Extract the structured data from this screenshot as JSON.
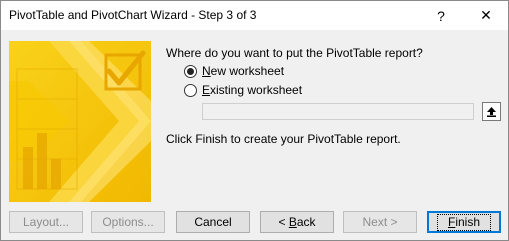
{
  "window": {
    "title": "PivotTable and PivotChart Wizard - Step 3 of 3",
    "help_label": "?",
    "close_label": "✕"
  },
  "form": {
    "question": "Where do you want to put the PivotTable report?",
    "options": [
      {
        "mnemonic": "N",
        "rest": "ew worksheet",
        "selected": true
      },
      {
        "mnemonic": "E",
        "rest": "xisting worksheet",
        "selected": false
      }
    ],
    "reference_value": "",
    "instructions": "Click Finish to create your PivotTable report."
  },
  "buttons": {
    "layout": {
      "mnemonic": "",
      "label": "Layout...",
      "enabled": false
    },
    "options": {
      "label": "Options...",
      "enabled": false
    },
    "cancel": {
      "label": "Cancel",
      "enabled": true
    },
    "back": {
      "pre": "< ",
      "mnemonic": "B",
      "rest": "ack",
      "enabled": true
    },
    "next": {
      "label": "Next >",
      "enabled": false
    },
    "finish": {
      "mnemonic": "F",
      "rest": "inish",
      "enabled": true,
      "default": true
    }
  },
  "icons": {
    "art": "wizard-pivot-art-icon",
    "collapse": "collapse-dialog-icon"
  },
  "colors": {
    "art_primary": "#f5c000",
    "art_highlight": "#ffe36a",
    "focus_border": "#0078d7",
    "disabled_text": "#8d8d8d"
  }
}
